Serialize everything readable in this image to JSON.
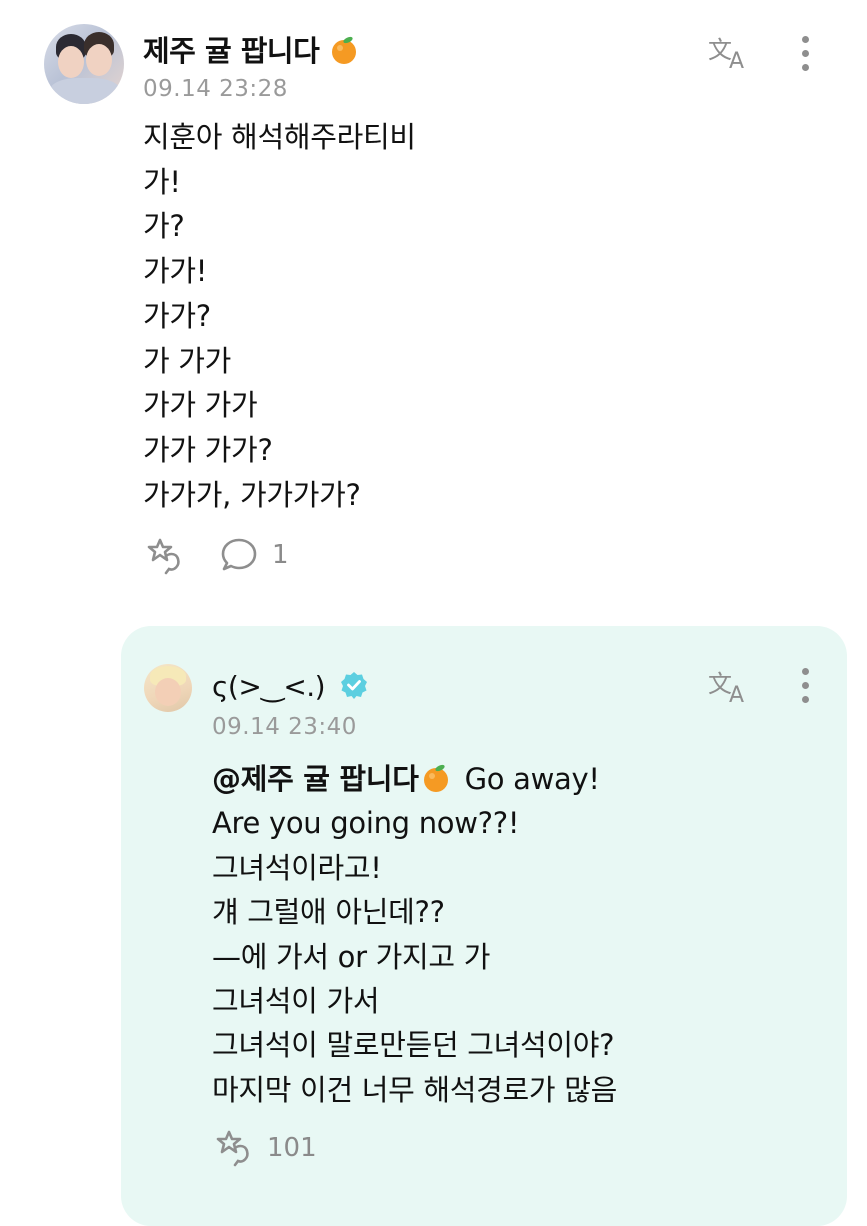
{
  "post": {
    "author": "제주 귤 팝니다",
    "author_emoji": "orange-emoji",
    "time": "09.14 23:28",
    "lines": [
      "지훈아 해석해주라티비",
      "가!",
      "가?",
      "가가!",
      "가가?",
      "가 가가",
      "가가 가가",
      "가가 가가?",
      "가가가, 가가가가?"
    ],
    "reaction_icon": "reaction-icon",
    "comment_count": "1"
  },
  "reply": {
    "author": "ς(>‿<.)",
    "verified_icon": "verified-badge-icon",
    "time": "09.14 23:40",
    "mention": "@제주 귤 팝니다",
    "first_line_rest": "Go away!",
    "lines": [
      "Are you going now??!",
      "그녀석이라고!",
      "걔 그럴애 아닌데??",
      "—에 가서 or 가지고 가",
      "그녀석이 가서",
      "그녀석이 말로만듣던 그녀석이야?",
      "마지막 이건 너무 해석경로가 많음"
    ],
    "reaction_count": "101"
  },
  "colors": {
    "reply_background": "#e8f8f4",
    "verified": "#5ccfe0",
    "muted_text": "#9a9a9a",
    "icon_gray": "#8e8e8e"
  }
}
